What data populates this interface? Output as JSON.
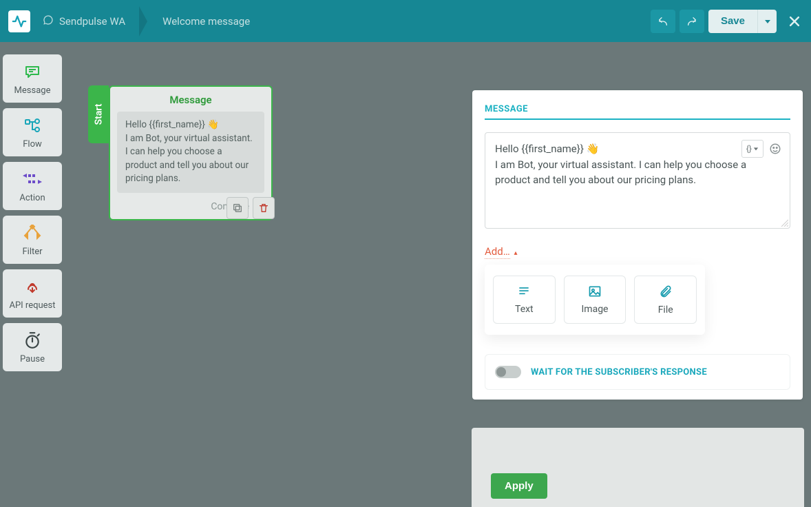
{
  "breadcrumb": {
    "bot_name": "Sendpulse WA",
    "flow_name": "Welcome message"
  },
  "topbar": {
    "save_label": "Save"
  },
  "rail": {
    "items": [
      {
        "label": "Message"
      },
      {
        "label": "Flow"
      },
      {
        "label": "Action"
      },
      {
        "label": "Filter"
      },
      {
        "label": "API request"
      },
      {
        "label": "Pause"
      }
    ]
  },
  "canvas": {
    "start_label": "Start",
    "card_title": "Message",
    "card_body_line1": "Hello {{first_name}} 👋",
    "card_body_line2": "I am Bot, your virtual assistant. I can help you choose a product and tell you about our pricing plans.",
    "continue_label": "Continue"
  },
  "panel": {
    "section_title": "MESSAGE",
    "message_line1": "Hello {{first_name}} 👋",
    "message_line2": "I am Bot, your virtual assistant. I can help you choose a product and tell you about our pricing plans.",
    "variable_button": "{}",
    "add_label": "Add…",
    "tiles": {
      "text": "Text",
      "image": "Image",
      "file": "File"
    },
    "wait_label": "WAIT FOR THE SUBSCRIBER'S RESPONSE",
    "apply_label": "Apply"
  }
}
